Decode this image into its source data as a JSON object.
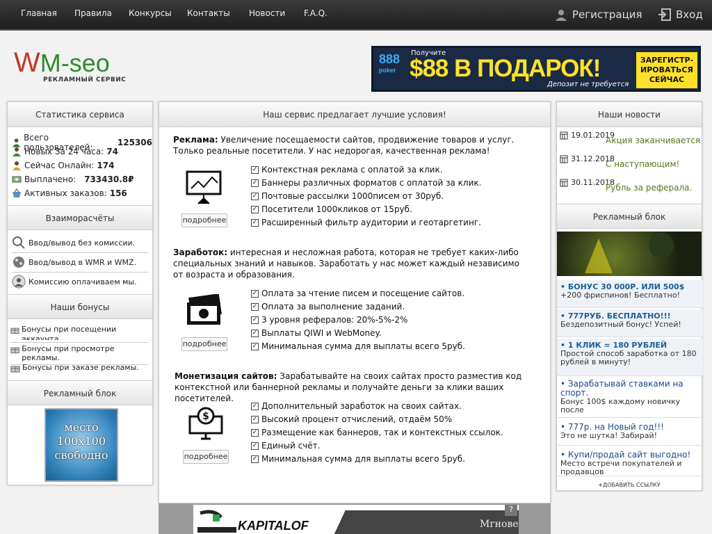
{
  "nav": {
    "items": [
      "Главная",
      "Правила",
      "Конкурсы",
      "Контакты",
      "Новости",
      "F.A.Q."
    ]
  },
  "auth": {
    "register": "Регистрация",
    "login": "Вход"
  },
  "logo": {
    "main_w": "W",
    "main_rest": "M-seo",
    "sub": "РЕКЛАМНЫЙ СЕРВИС"
  },
  "top_banner": {
    "brand": "888",
    "brand_sub": "poker",
    "get": "Получите",
    "headline": "$88 В ПОДАРОК!",
    "deposit": "Депозит не требуется",
    "cta": "ЗАРЕГИСТР-ИРОВАТЬСЯ СЕЙЧАС"
  },
  "left": {
    "stats_title": "Статистика сервиса",
    "stats": [
      {
        "label": "Всего пользователей:",
        "value": "125306"
      },
      {
        "label": "Новых За 24 часа:",
        "value": "74"
      },
      {
        "label": "Сейчас Онлайн:",
        "value": "174"
      },
      {
        "label": "Выплачено:",
        "value": "733430.8₽"
      },
      {
        "label": "Активных заказов:",
        "value": "156"
      }
    ],
    "settle_title": "Взаиморасчёты",
    "settle": [
      "Ввод/вывод без комиссии.",
      "Ввод/вывод в WMR и WMZ.",
      "Комиссию оплачиваем мы."
    ],
    "bonus_title": "Наши бонусы",
    "bonus": [
      "Бонусы при посещении аккаунта.",
      "Бонусы при просмотре рекламы.",
      "Бонусы при заказе рекламы."
    ],
    "ad_title": "Рекламный блок",
    "ad_text": "место 100x100 свободно"
  },
  "center": {
    "title": "Наш сервис предлагает лучшие условия!",
    "sections": [
      {
        "heading": "Реклама:",
        "text": "Увеличение посещаемости сайтов, продвижение товаров и услуг. Только реальные посетители. У нас недорогая, качественная реклама!",
        "features": [
          "Контекстная реклама с оплатой за клик.",
          "Баннеры различных форматов с оплатой за клик.",
          "Почтовые рассылки 1000писем от 30руб.",
          "Посетители 1000кликов от 15руб.",
          "Расширенный фильтр аудитории и геотаргетинг."
        ]
      },
      {
        "heading": "Заработок:",
        "text": "интересная и несложная работа, которая не требует каких-либо специальных знаний и навыков. Заработать у нас может каждый независимо от возраста и образования.",
        "features": [
          "Оплата за чтение писем и посещение сайтов.",
          "Оплата за выполнение заданий.",
          "3 уровня рефералов: 20%-5%-2%",
          "Выплаты QIWI и WebMoney.",
          "Минимальная сумма для выплаты всего 5руб."
        ]
      },
      {
        "heading": "Монетизация сайтов:",
        "text": "Зарабатывайте на своих сайтах просто разместив код контекстной или баннерной рекламы и получайте деньги за клики ваших посетителей.",
        "features": [
          "Дополнительный заработок на своих сайтах.",
          "Высокий процент отчислений, отдаём 50%",
          "Размещение как баннеров, так и контекстных ссылок.",
          "Единый счёт.",
          "Минимальная сумма для выплаты всего 5руб."
        ]
      }
    ],
    "more": "подробнее",
    "bottom_banner": {
      "brand": "KAPITALOF",
      "text": "Мгнове",
      "q": "?"
    }
  },
  "right": {
    "news_title": "Наши новости",
    "news": [
      {
        "date": "19.01.2019",
        "title": "Акция заканчивается"
      },
      {
        "date": "31.12.2018",
        "title": "С наступающим!"
      },
      {
        "date": "30.11.2018",
        "title": "Рубль за реферала."
      }
    ],
    "ad_title": "Рекламный блок",
    "links": [
      {
        "title": "• БОНУС 30 000Р. ИЛИ 500$",
        "desc": "+200 фриспинов! Бесплатно!"
      },
      {
        "title": "• 777РУБ. БЕСПЛАТНО!!!",
        "desc": "Бездепозитный бонус! Успей!"
      },
      {
        "title": "• 1 КЛИК = 180 РУБЛЕЙ",
        "desc": "Простой способ заработка от 180 рублей в минуту!"
      },
      {
        "title": "• Зарабатывай ставками на спорт.",
        "desc": "Бонус 100$ каждому новичку после"
      },
      {
        "title": "• 777р. на Новый год!!!",
        "desc": "Это не шутка! Забирай!"
      },
      {
        "title": "• Купи/продай сайт выгодно!",
        "desc": "Место встречи покупателей и продавцов"
      }
    ],
    "add_link": "ДОБАВИТЬ ССЫЛКУ"
  },
  "colors": {
    "green": "#2e8b2e",
    "link_blue": "#1a5e9a",
    "news_green": "#4a7a1d",
    "banner_yellow": "#ffe12a"
  }
}
